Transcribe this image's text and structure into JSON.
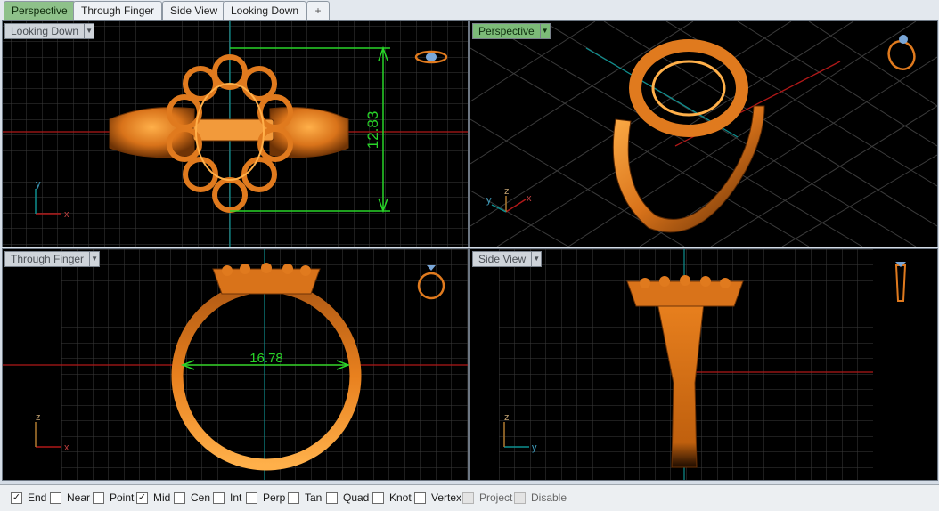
{
  "tabs": [
    {
      "label": "Perspective",
      "active": true
    },
    {
      "label": "Through Finger",
      "active": false
    },
    {
      "label": "Side View",
      "active": false
    },
    {
      "label": "Looking Down",
      "active": false
    }
  ],
  "add_tab_glyph": "+",
  "viewports": {
    "top_left": {
      "label": "Looking Down",
      "active": false,
      "dimension": "12.83",
      "axis_x": "x",
      "axis_y": "y"
    },
    "top_right": {
      "label": "Perspective",
      "active": true,
      "axis_x": "x",
      "axis_y": "y",
      "axis_z": "z"
    },
    "bottom_left": {
      "label": "Through Finger",
      "active": false,
      "dimension": "16.78",
      "axis_x": "x",
      "axis_z": "z"
    },
    "bottom_right": {
      "label": "Side View",
      "active": false,
      "axis_y": "y",
      "axis_z": "z"
    }
  },
  "osnaps": [
    {
      "label": "End",
      "checked": true
    },
    {
      "label": "Near",
      "checked": false
    },
    {
      "label": "Point",
      "checked": false
    },
    {
      "label": "Mid",
      "checked": true
    },
    {
      "label": "Cen",
      "checked": false
    },
    {
      "label": "Int",
      "checked": false
    },
    {
      "label": "Perp",
      "checked": false
    },
    {
      "label": "Tan",
      "checked": false
    },
    {
      "label": "Quad",
      "checked": false
    },
    {
      "label": "Knot",
      "checked": false
    },
    {
      "label": "Vertex",
      "checked": false
    },
    {
      "label": "Project",
      "checked": false
    },
    {
      "label": "Disable",
      "checked": false
    }
  ],
  "check_glyph": "✓",
  "colors": {
    "viewport_bg": "#000000",
    "grid": "#3b3b3b",
    "axis_red": "#b01818",
    "axis_green": "#0e8f8f",
    "ring_gold": "#e07a1e",
    "ring_dark": "#7a3a08",
    "dimension_green": "#28d428",
    "active_tab": "#8ec18a"
  }
}
